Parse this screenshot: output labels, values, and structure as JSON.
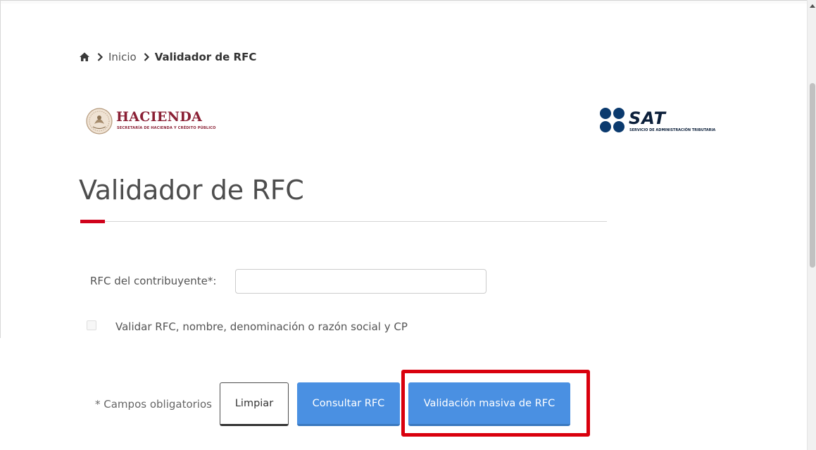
{
  "breadcrumb": {
    "home_icon": "home-icon",
    "items": [
      "Inicio",
      "Validador de RFC"
    ]
  },
  "logos": {
    "hacienda": {
      "name": "HACIENDA",
      "subtitle": "SECRETARÍA DE HACIENDA Y CRÉDITO PÚBLICO",
      "color": "#8a2035"
    },
    "sat": {
      "name": "SAT",
      "subtitle": "SERVICIO DE ADMINISTRACIÓN TRIBUTARIA",
      "color": "#0b1f3a",
      "dot_color": "#0b3a6e"
    }
  },
  "page": {
    "title": "Validador de RFC",
    "accent_color": "#d0021b"
  },
  "form": {
    "rfc_label": "RFC del contribuyente*:",
    "rfc_value": "",
    "rfc_placeholder": "",
    "checkbox_label": "Validar RFC, nombre, denominación o razón social y CP",
    "checkbox_checked": false,
    "required_note": "* Campos obligatorios"
  },
  "buttons": {
    "clear_label": "Limpiar",
    "query_label": "Consultar RFC",
    "mass_label": "Validación masiva de RFC",
    "primary_color": "#4a90e2"
  },
  "annotation": {
    "highlight_color": "#d9000d"
  }
}
